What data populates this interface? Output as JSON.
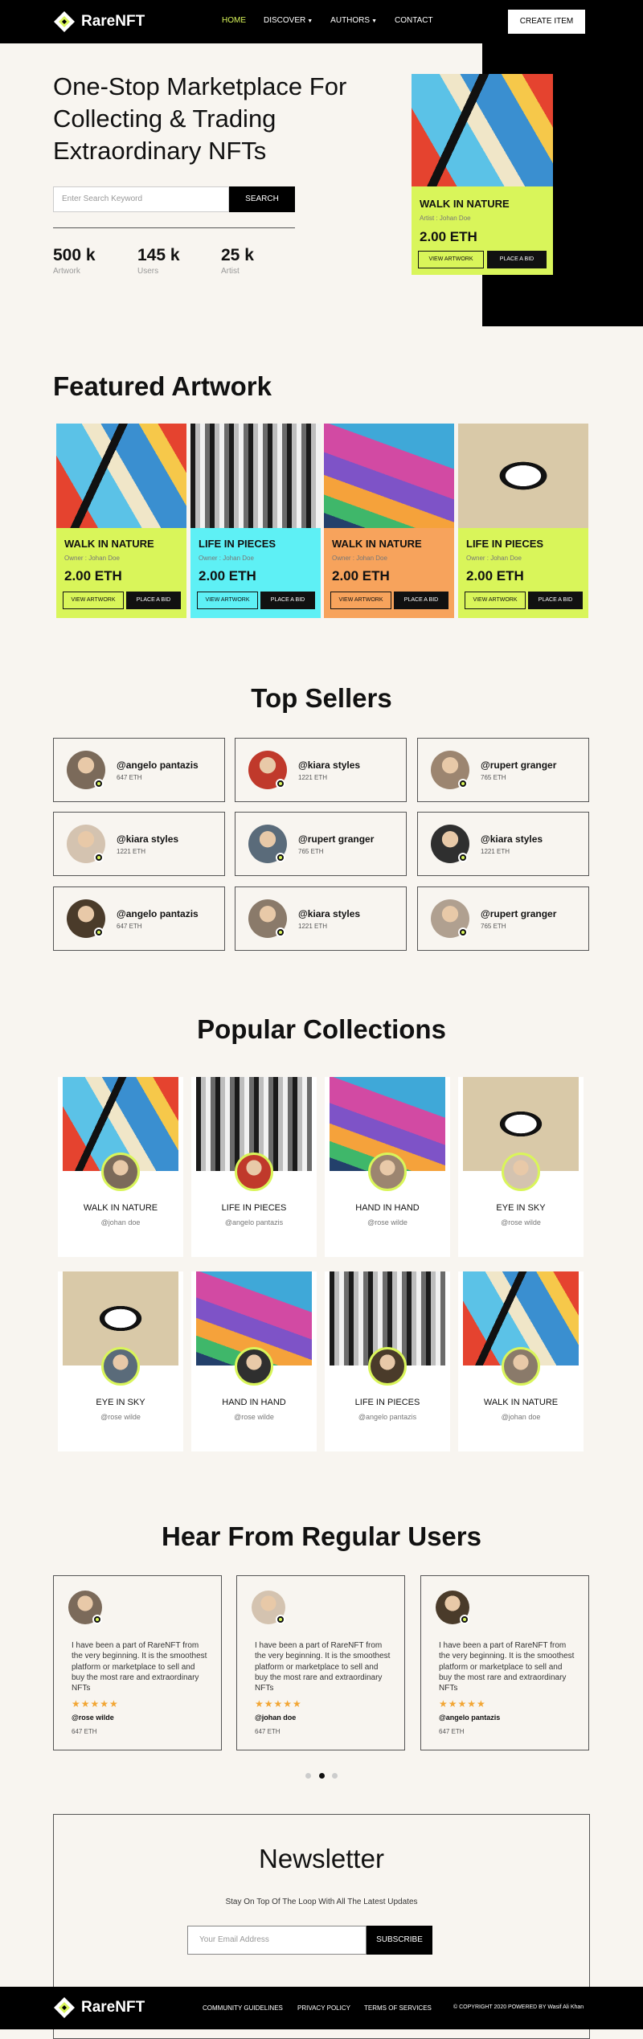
{
  "brand": {
    "name": "RareNFT",
    "accent_color": "#d9f55a"
  },
  "nav": {
    "items": [
      {
        "label": "HOME",
        "active": true
      },
      {
        "label": "DISCOVER",
        "has_dropdown": true
      },
      {
        "label": "AUTHORS",
        "has_dropdown": true
      },
      {
        "label": "CONTACT"
      }
    ],
    "create_button": "CREATE ITEM"
  },
  "hero": {
    "title": "One-Stop Marketplace For Collecting & Trading Extraordinary NFTs",
    "search_placeholder": "Enter Search Keyword",
    "search_button": "SEARCH",
    "stats": [
      {
        "value": "500 k",
        "label": "Artwork"
      },
      {
        "value": "145 k",
        "label": "Users"
      },
      {
        "value": "25 k",
        "label": "Artist"
      }
    ],
    "card": {
      "title": "WALK IN NATURE",
      "owner": "Artist : Johan Doe",
      "price": "2.00 ETH",
      "view_button": "VIEW ARTWORK",
      "bid_button": "PLACE A BID"
    }
  },
  "featured": {
    "title": "Featured Artwork",
    "cards": [
      {
        "title": "WALK IN NATURE",
        "owner": "Owner : Johan Doe",
        "price": "2.00 ETH",
        "view_button": "VIEW ARTWORK",
        "bid_button": "PLACE A BID",
        "color": "#d9f55a",
        "art": "walk"
      },
      {
        "title": "LIFE IN PIECES",
        "owner": "Owner : Johan Doe",
        "price": "2.00 ETH",
        "view_button": "VIEW ARTWORK",
        "bid_button": "PLACE A BID",
        "color": "#5ef0f5",
        "art": "life"
      },
      {
        "title": "WALK IN NATURE",
        "owner": "Owner : Johan Doe",
        "price": "2.00 ETH",
        "view_button": "VIEW ARTWORK",
        "bid_button": "PLACE A BID",
        "color": "#f7a35c",
        "art": "hand"
      },
      {
        "title": "LIFE IN PIECES",
        "owner": "Owner : Johan Doe",
        "price": "2.00 ETH",
        "view_button": "VIEW ARTWORK",
        "bid_button": "PLACE A BID",
        "color": "#d9f55a",
        "art": "eye"
      }
    ]
  },
  "sellers": {
    "title": "Top Sellers",
    "items": [
      {
        "name": "@angelo pantazis",
        "eth": "647 ETH"
      },
      {
        "name": "@kiara styles",
        "eth": "1221 ETH"
      },
      {
        "name": "@rupert granger",
        "eth": "765 ETH"
      },
      {
        "name": "@kiara styles",
        "eth": "1221 ETH"
      },
      {
        "name": "@rupert granger",
        "eth": "765 ETH"
      },
      {
        "name": "@kiara styles",
        "eth": "1221 ETH"
      },
      {
        "name": "@angelo pantazis",
        "eth": "647 ETH"
      },
      {
        "name": "@kiara styles",
        "eth": "1221 ETH"
      },
      {
        "name": "@rupert granger",
        "eth": "765 ETH"
      }
    ]
  },
  "collections": {
    "title": "Popular Collections",
    "items": [
      {
        "title": "WALK IN NATURE",
        "owner": "@johan doe",
        "art": "walk"
      },
      {
        "title": "LIFE IN PIECES",
        "owner": "@angelo pantazis",
        "art": "life"
      },
      {
        "title": "HAND IN HAND",
        "owner": "@rose wilde",
        "art": "hand"
      },
      {
        "title": "EYE IN SKY",
        "owner": "@rose wilde",
        "art": "eye"
      },
      {
        "title": "EYE IN SKY",
        "owner": "@rose wilde",
        "art": "eye"
      },
      {
        "title": "HAND IN HAND",
        "owner": "@rose wilde",
        "art": "hand"
      },
      {
        "title": "LIFE IN PIECES",
        "owner": "@angelo pantazis",
        "art": "life"
      },
      {
        "title": "WALK IN NATURE",
        "owner": "@johan doe",
        "art": "walk"
      }
    ]
  },
  "testimonials": {
    "title": "Hear From Regular Users",
    "items": [
      {
        "text": "I have been a part of RareNFT from the very beginning. It is the smoothest platform or marketplace to sell and buy the most rare and extraordinary NFTs",
        "stars": "★★★★★",
        "name": "@rose wilde",
        "eth": "647 ETH"
      },
      {
        "text": "I have been a part of RareNFT from the very beginning. It is the smoothest platform or marketplace to sell and buy the most rare and extraordinary NFTs",
        "stars": "★★★★★",
        "name": "@johan doe",
        "eth": "647 ETH"
      },
      {
        "text": "I have been a part of RareNFT from the very beginning. It is the smoothest platform or marketplace to sell and buy the most rare and extraordinary NFTs",
        "stars": "★★★★★",
        "name": "@angelo pantazis",
        "eth": "647 ETH"
      }
    ],
    "active_dot": 2,
    "dot_count": 3
  },
  "newsletter": {
    "title": "Newsletter",
    "subtitle": "Stay On Top Of The Loop With All The Latest Updates",
    "placeholder": "Your Email Address",
    "button": "SUBSCRIBE"
  },
  "footer": {
    "links": [
      "COMMUNITY GUIDELINES",
      "PRIVACY POLICY",
      "TERMS OF SERVICES"
    ],
    "copyright": "© COPYRIGHT 2020 POWERED BY Wasif Ali Khan"
  }
}
